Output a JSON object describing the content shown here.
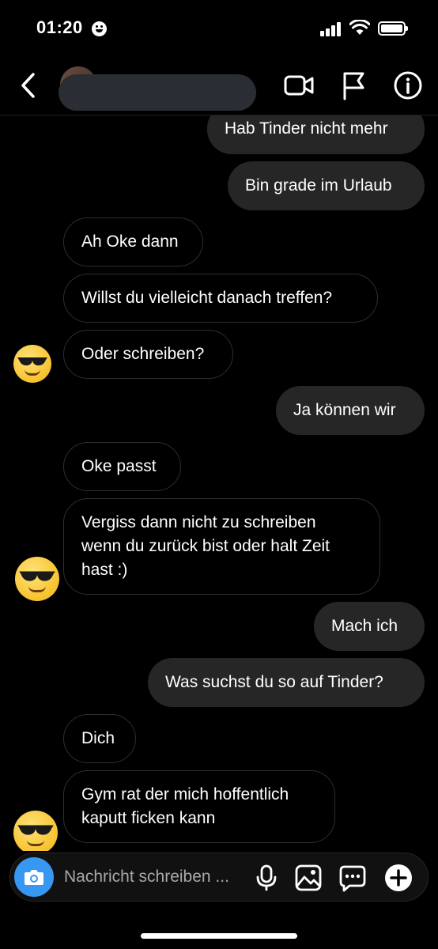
{
  "status_bar": {
    "time": "01:20"
  },
  "header": {
    "back_icon": "chevron-left-icon",
    "video_icon": "video-camera-icon",
    "flag_icon": "flag-icon",
    "info_icon": "info-icon"
  },
  "messages": [
    {
      "text": "Hab Tinder nicht mehr",
      "from": "me"
    },
    {
      "text": "Bin grade im Urlaub",
      "from": "me"
    },
    {
      "text": "Ah Oke dann",
      "from": "them"
    },
    {
      "text": "Willst du vielleicht danach treffen?",
      "from": "them"
    },
    {
      "text": "Oder schreiben?",
      "from": "them"
    },
    {
      "text": "Ja können wir",
      "from": "me"
    },
    {
      "text": "Oke passt",
      "from": "them"
    },
    {
      "text": "Vergiss dann nicht zu schreiben\nwenn du zurück bist oder halt Zeit\nhast :)",
      "from": "them"
    },
    {
      "text": "Mach ich",
      "from": "me"
    },
    {
      "text": "Was suchst du so auf Tinder?",
      "from": "me"
    },
    {
      "text": "Dich",
      "from": "them"
    },
    {
      "text": "Gym rat der mich hoffentlich\nkaputt ficken kann",
      "from": "them"
    }
  ],
  "composer": {
    "placeholder": "Nachricht schreiben ...",
    "icons": [
      "camera-icon",
      "microphone-icon",
      "image-icon",
      "sticker-icon",
      "plus-icon"
    ]
  },
  "colors": {
    "background": "#000000",
    "sent_bubble": "#262626",
    "received_border": "#2e2e2e",
    "camera_button": "#3897f0"
  }
}
